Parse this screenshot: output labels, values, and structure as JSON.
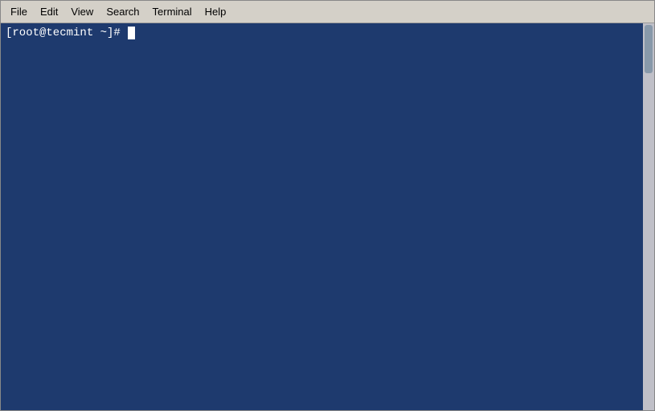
{
  "menubar": {
    "items": [
      {
        "id": "file",
        "label": "File"
      },
      {
        "id": "edit",
        "label": "Edit"
      },
      {
        "id": "view",
        "label": "View"
      },
      {
        "id": "search",
        "label": "Search"
      },
      {
        "id": "terminal",
        "label": "Terminal"
      },
      {
        "id": "help",
        "label": "Help"
      }
    ]
  },
  "terminal": {
    "prompt": "[root@tecmint ~]# "
  },
  "colors": {
    "terminal_bg": "#1e3a6e",
    "menubar_bg": "#d4d0c8",
    "text": "#ffffff"
  }
}
